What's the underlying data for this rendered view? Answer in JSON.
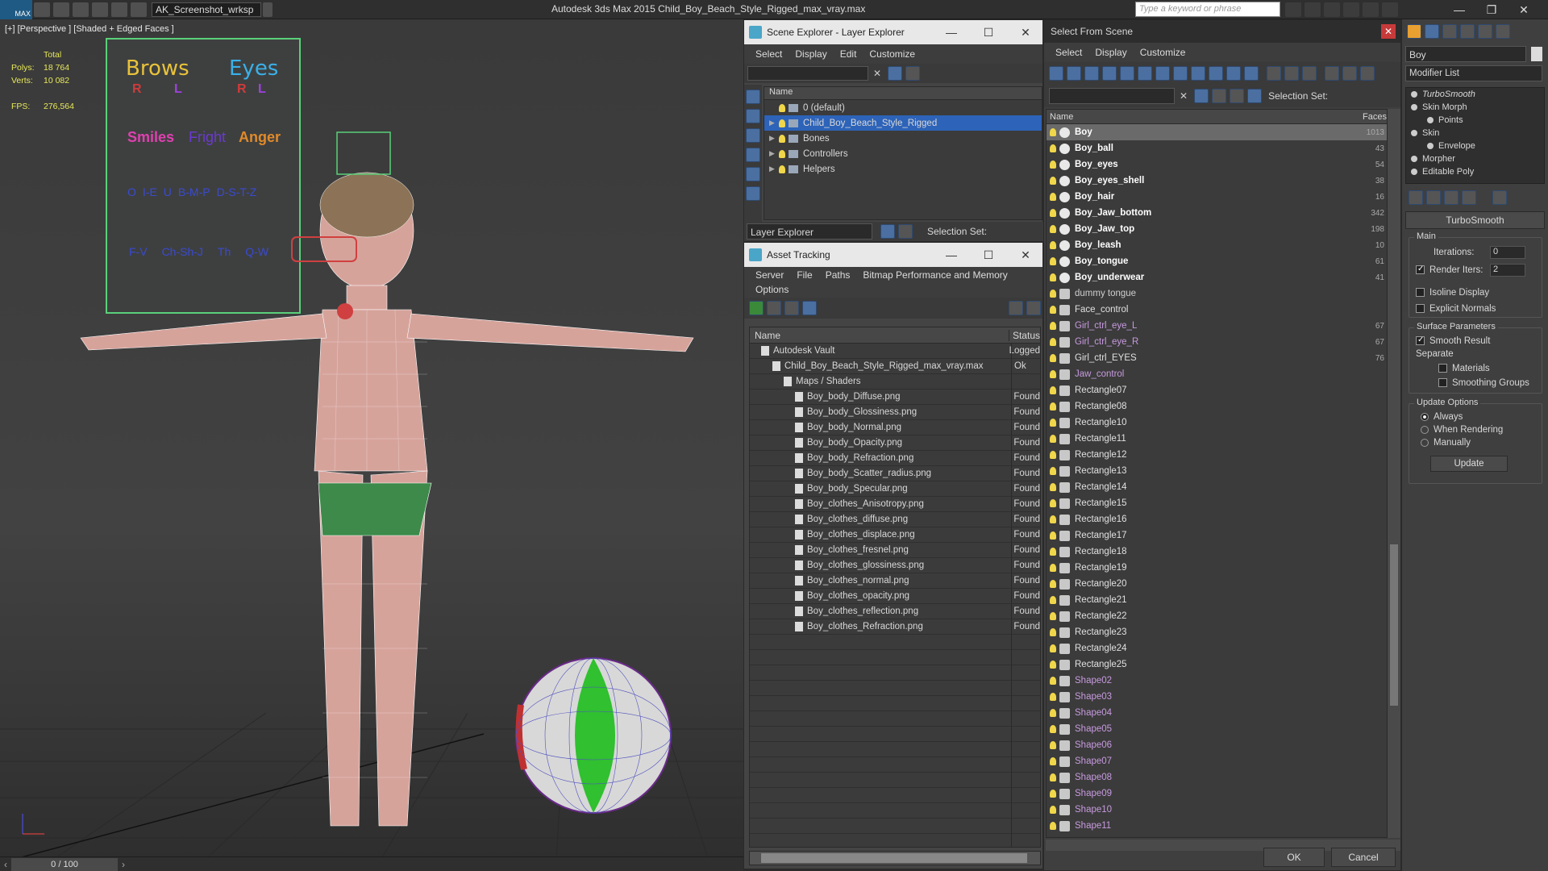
{
  "app": {
    "title": "Autodesk 3ds Max  2015    Child_Boy_Beach_Style_Rigged_max_vray.max",
    "logo": "MAX",
    "workspace": "AK_Screenshot_wrksp",
    "search_placeholder": "Type a keyword or phrase"
  },
  "viewport": {
    "label": "[+] [Perspective ] [Shaded + Edged Faces ]",
    "stats": {
      "total_label": "Total",
      "polys_label": "Polys:",
      "polys": "18 764",
      "verts_label": "Verts:",
      "verts": "10 082",
      "fps_label": "FPS:",
      "fps": "276,564"
    },
    "face_board": {
      "brows": "Brows",
      "eyes": "Eyes",
      "r": "R",
      "l": "L",
      "smiles": "Smiles",
      "fright": "Fright",
      "anger": "Anger",
      "visemes1": [
        "O",
        "I-E",
        "U",
        "B-M-P",
        "D-S-T-Z"
      ],
      "visemes2": [
        "F-V",
        "Ch-Sh-J",
        "Th",
        "Q-W"
      ]
    },
    "timeline": "0 / 100"
  },
  "scene_explorer": {
    "title": "Scene Explorer - Layer Explorer",
    "menu": [
      "Select",
      "Display",
      "Edit",
      "Customize"
    ],
    "col_name": "Name",
    "layers": [
      {
        "name": "0 (default)",
        "selected": false,
        "expand": false
      },
      {
        "name": "Child_Boy_Beach_Style_Rigged",
        "selected": true,
        "expand": true
      },
      {
        "name": "Bones",
        "selected": false,
        "expand": true
      },
      {
        "name": "Controllers",
        "selected": false,
        "expand": true
      },
      {
        "name": "Helpers",
        "selected": false,
        "expand": true
      }
    ],
    "footer_dropdown": "Layer Explorer",
    "selection_set": "Selection Set:"
  },
  "asset_tracking": {
    "title": "Asset Tracking",
    "menu": [
      "Server",
      "File",
      "Paths",
      "Bitmap Performance and Memory",
      "Options"
    ],
    "col_name": "Name",
    "col_status": "Status",
    "rows": [
      {
        "name": "Autodesk Vault",
        "status": "Logged",
        "indent": 1
      },
      {
        "name": "Child_Boy_Beach_Style_Rigged_max_vray.max",
        "status": "Ok",
        "indent": 2
      },
      {
        "name": "Maps / Shaders",
        "status": "",
        "indent": 3
      },
      {
        "name": "Boy_body_Diffuse.png",
        "status": "Found",
        "indent": 4
      },
      {
        "name": "Boy_body_Glossiness.png",
        "status": "Found",
        "indent": 4
      },
      {
        "name": "Boy_body_Normal.png",
        "status": "Found",
        "indent": 4
      },
      {
        "name": "Boy_body_Opacity.png",
        "status": "Found",
        "indent": 4
      },
      {
        "name": "Boy_body_Refraction.png",
        "status": "Found",
        "indent": 4
      },
      {
        "name": "Boy_body_Scatter_radius.png",
        "status": "Found",
        "indent": 4
      },
      {
        "name": "Boy_body_Specular.png",
        "status": "Found",
        "indent": 4
      },
      {
        "name": "Boy_clothes_Anisotropy.png",
        "status": "Found",
        "indent": 4
      },
      {
        "name": "Boy_clothes_diffuse.png",
        "status": "Found",
        "indent": 4
      },
      {
        "name": "Boy_clothes_displace.png",
        "status": "Found",
        "indent": 4
      },
      {
        "name": "Boy_clothes_fresnel.png",
        "status": "Found",
        "indent": 4
      },
      {
        "name": "Boy_clothes_glossiness.png",
        "status": "Found",
        "indent": 4
      },
      {
        "name": "Boy_clothes_normal.png",
        "status": "Found",
        "indent": 4
      },
      {
        "name": "Boy_clothes_opacity.png",
        "status": "Found",
        "indent": 4
      },
      {
        "name": "Boy_clothes_reflection.png",
        "status": "Found",
        "indent": 4
      },
      {
        "name": "Boy_clothes_Refraction.png",
        "status": "Found",
        "indent": 4
      }
    ]
  },
  "select_from_scene": {
    "title": "Select From Scene",
    "menu": [
      "Select",
      "Display",
      "Customize"
    ],
    "selection_set": "Selection Set:",
    "col_name": "Name",
    "col_faces": "Faces",
    "rows": [
      {
        "name": "Boy",
        "faces": "1013",
        "kind": "mesh",
        "bold": true,
        "color": "#ffffff",
        "selected": true
      },
      {
        "name": "Boy_ball",
        "faces": "43",
        "kind": "mesh",
        "bold": true,
        "color": "#ffffff"
      },
      {
        "name": "Boy_eyes",
        "faces": "54",
        "kind": "mesh",
        "bold": true,
        "color": "#ffffff"
      },
      {
        "name": "Boy_eyes_shell",
        "faces": "38",
        "kind": "mesh",
        "bold": true,
        "color": "#ffffff"
      },
      {
        "name": "Boy_hair",
        "faces": "16",
        "kind": "mesh",
        "bold": true,
        "color": "#ffffff"
      },
      {
        "name": "Boy_Jaw_bottom",
        "faces": "342",
        "kind": "mesh",
        "bold": true,
        "color": "#ffffff"
      },
      {
        "name": "Boy_Jaw_top",
        "faces": "198",
        "kind": "mesh",
        "bold": true,
        "color": "#ffffff"
      },
      {
        "name": "Boy_leash",
        "faces": "10",
        "kind": "mesh",
        "bold": true,
        "color": "#ffffff"
      },
      {
        "name": "Boy_tongue",
        "faces": "61",
        "kind": "mesh",
        "bold": true,
        "color": "#ffffff"
      },
      {
        "name": "Boy_underwear",
        "faces": "41",
        "kind": "mesh",
        "bold": true,
        "color": "#ffffff"
      },
      {
        "name": "dummy tongue",
        "faces": "",
        "kind": "dummy",
        "bold": false,
        "color": "#cfcfcf"
      },
      {
        "name": "Face_control",
        "faces": "",
        "kind": "shape",
        "bold": false,
        "color": "#e0e0e0"
      },
      {
        "name": "Girl_ctrl_eye_L",
        "faces": "67",
        "kind": "shape",
        "bold": false,
        "color": "#c79adf"
      },
      {
        "name": "Girl_ctrl_eye_R",
        "faces": "67",
        "kind": "shape",
        "bold": false,
        "color": "#c79adf"
      },
      {
        "name": "Girl_ctrl_EYES",
        "faces": "76",
        "kind": "shape",
        "bold": false,
        "color": "#e0e0e0"
      },
      {
        "name": "Jaw_control",
        "faces": "",
        "kind": "shape",
        "bold": false,
        "color": "#c79adf"
      },
      {
        "name": "Rectangle07",
        "faces": "",
        "kind": "shape",
        "bold": false,
        "color": "#e0e0e0"
      },
      {
        "name": "Rectangle08",
        "faces": "",
        "kind": "shape",
        "bold": false,
        "color": "#e0e0e0"
      },
      {
        "name": "Rectangle10",
        "faces": "",
        "kind": "shape",
        "bold": false,
        "color": "#e0e0e0"
      },
      {
        "name": "Rectangle11",
        "faces": "",
        "kind": "shape",
        "bold": false,
        "color": "#e0e0e0"
      },
      {
        "name": "Rectangle12",
        "faces": "",
        "kind": "shape",
        "bold": false,
        "color": "#e0e0e0"
      },
      {
        "name": "Rectangle13",
        "faces": "",
        "kind": "shape",
        "bold": false,
        "color": "#e0e0e0"
      },
      {
        "name": "Rectangle14",
        "faces": "",
        "kind": "shape",
        "bold": false,
        "color": "#e0e0e0"
      },
      {
        "name": "Rectangle15",
        "faces": "",
        "kind": "shape",
        "bold": false,
        "color": "#e0e0e0"
      },
      {
        "name": "Rectangle16",
        "faces": "",
        "kind": "shape",
        "bold": false,
        "color": "#e0e0e0"
      },
      {
        "name": "Rectangle17",
        "faces": "",
        "kind": "shape",
        "bold": false,
        "color": "#e0e0e0"
      },
      {
        "name": "Rectangle18",
        "faces": "",
        "kind": "shape",
        "bold": false,
        "color": "#e0e0e0"
      },
      {
        "name": "Rectangle19",
        "faces": "",
        "kind": "shape",
        "bold": false,
        "color": "#e0e0e0"
      },
      {
        "name": "Rectangle20",
        "faces": "",
        "kind": "shape",
        "bold": false,
        "color": "#e0e0e0"
      },
      {
        "name": "Rectangle21",
        "faces": "",
        "kind": "shape",
        "bold": false,
        "color": "#e0e0e0"
      },
      {
        "name": "Rectangle22",
        "faces": "",
        "kind": "shape",
        "bold": false,
        "color": "#e0e0e0"
      },
      {
        "name": "Rectangle23",
        "faces": "",
        "kind": "shape",
        "bold": false,
        "color": "#e0e0e0"
      },
      {
        "name": "Rectangle24",
        "faces": "",
        "kind": "shape",
        "bold": false,
        "color": "#e0e0e0"
      },
      {
        "name": "Rectangle25",
        "faces": "",
        "kind": "shape",
        "bold": false,
        "color": "#e0e0e0"
      },
      {
        "name": "Shape02",
        "faces": "",
        "kind": "shape",
        "bold": false,
        "color": "#c79adf"
      },
      {
        "name": "Shape03",
        "faces": "",
        "kind": "shape",
        "bold": false,
        "color": "#c79adf"
      },
      {
        "name": "Shape04",
        "faces": "",
        "kind": "shape",
        "bold": false,
        "color": "#c79adf"
      },
      {
        "name": "Shape05",
        "faces": "",
        "kind": "shape",
        "bold": false,
        "color": "#c79adf"
      },
      {
        "name": "Shape06",
        "faces": "",
        "kind": "shape",
        "bold": false,
        "color": "#c79adf"
      },
      {
        "name": "Shape07",
        "faces": "",
        "kind": "shape",
        "bold": false,
        "color": "#c79adf"
      },
      {
        "name": "Shape08",
        "faces": "",
        "kind": "shape",
        "bold": false,
        "color": "#c79adf"
      },
      {
        "name": "Shape09",
        "faces": "",
        "kind": "shape",
        "bold": false,
        "color": "#c79adf"
      },
      {
        "name": "Shape10",
        "faces": "",
        "kind": "shape",
        "bold": false,
        "color": "#c79adf"
      },
      {
        "name": "Shape11",
        "faces": "",
        "kind": "shape",
        "bold": false,
        "color": "#c79adf"
      }
    ],
    "ok": "OK",
    "cancel": "Cancel"
  },
  "command_panel": {
    "name_value": "Boy",
    "modifier_list": "Modifier List",
    "stack": [
      {
        "name": "TurboSmooth",
        "italic": true,
        "indent": 0
      },
      {
        "name": "Skin Morph",
        "italic": false,
        "indent": 0
      },
      {
        "name": "Points",
        "italic": false,
        "indent": 1
      },
      {
        "name": "Skin",
        "italic": false,
        "indent": 0
      },
      {
        "name": "Envelope",
        "italic": false,
        "indent": 1
      },
      {
        "name": "Morpher",
        "italic": false,
        "indent": 0
      },
      {
        "name": "Editable Poly",
        "italic": false,
        "indent": 0
      }
    ],
    "rollout": "TurboSmooth",
    "main": "Main",
    "iterations_label": "Iterations:",
    "iterations": "0",
    "render_iters_label": "Render Iters:",
    "render_iters": "2",
    "isoline": "Isoline Display",
    "explicit_normals": "Explicit Normals",
    "surface_params": "Surface Parameters",
    "smooth_result": "Smooth Result",
    "separate": "Separate",
    "materials": "Materials",
    "smoothing_groups": "Smoothing Groups",
    "update_options": "Update Options",
    "always": "Always",
    "when_rendering": "When Rendering",
    "manually": "Manually",
    "update": "Update"
  }
}
